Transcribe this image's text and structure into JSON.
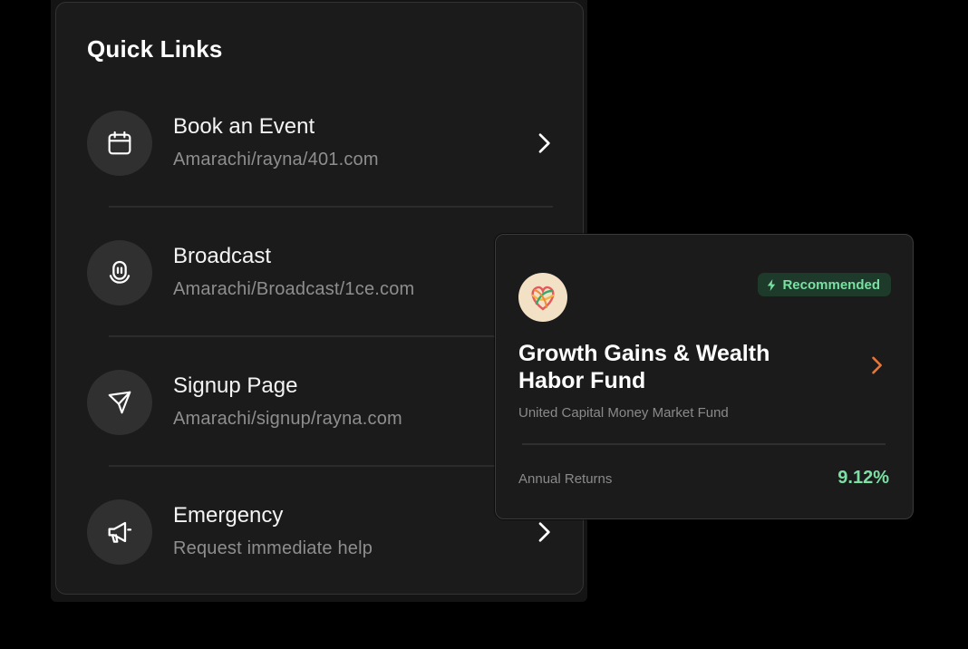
{
  "quick_links": {
    "title": "Quick Links",
    "items": [
      {
        "label": "Book an Event",
        "link": "Amarachi/rayna/401.com",
        "icon": "calendar-icon"
      },
      {
        "label": "Broadcast",
        "link": "Amarachi/Broadcast/1ce.com",
        "icon": "microphone-icon"
      },
      {
        "label": "Signup Page",
        "link": "Amarachi/signup/rayna.com",
        "icon": "send-icon"
      },
      {
        "label": "Emergency",
        "link": "Request immediate help",
        "icon": "megaphone-icon"
      }
    ]
  },
  "fund_card": {
    "badge": "Recommended",
    "name": "Growth Gains & Wealth Habor Fund",
    "subtitle": "United Capital Money Market Fund",
    "returns_label": "Annual Returns",
    "returns_value": "9.12%",
    "accent_color": "#e8763a",
    "positive_color": "#7be0a3"
  }
}
